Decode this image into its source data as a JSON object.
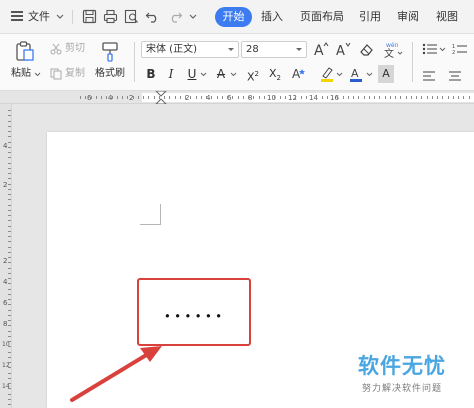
{
  "menubar": {
    "file_label": "文件",
    "tabs": [
      "开始",
      "插入",
      "页面布局",
      "引用",
      "审阅",
      "视图"
    ]
  },
  "ribbon": {
    "paste_label": "粘贴",
    "cut_label": "剪切",
    "copy_label": "复制",
    "format_painter_label": "格式刷",
    "font_name": "宋体 (正文)",
    "font_size": "28"
  },
  "ruler": {
    "h_numbers": [
      "6",
      "4",
      "2",
      "2",
      "4",
      "6",
      "8",
      "10",
      "12",
      "14",
      "16"
    ],
    "v_numbers": [
      "4",
      "2",
      "2",
      "4",
      "6",
      "8",
      "10",
      "12",
      "14"
    ]
  },
  "document": {
    "content": "......"
  },
  "watermark": {
    "title": "软件无忧",
    "subtitle": "努力解决软件问题"
  },
  "colors": {
    "accent": "#3d7cf0",
    "annotation": "#d9423c",
    "watermark": "#4aa6e0"
  }
}
